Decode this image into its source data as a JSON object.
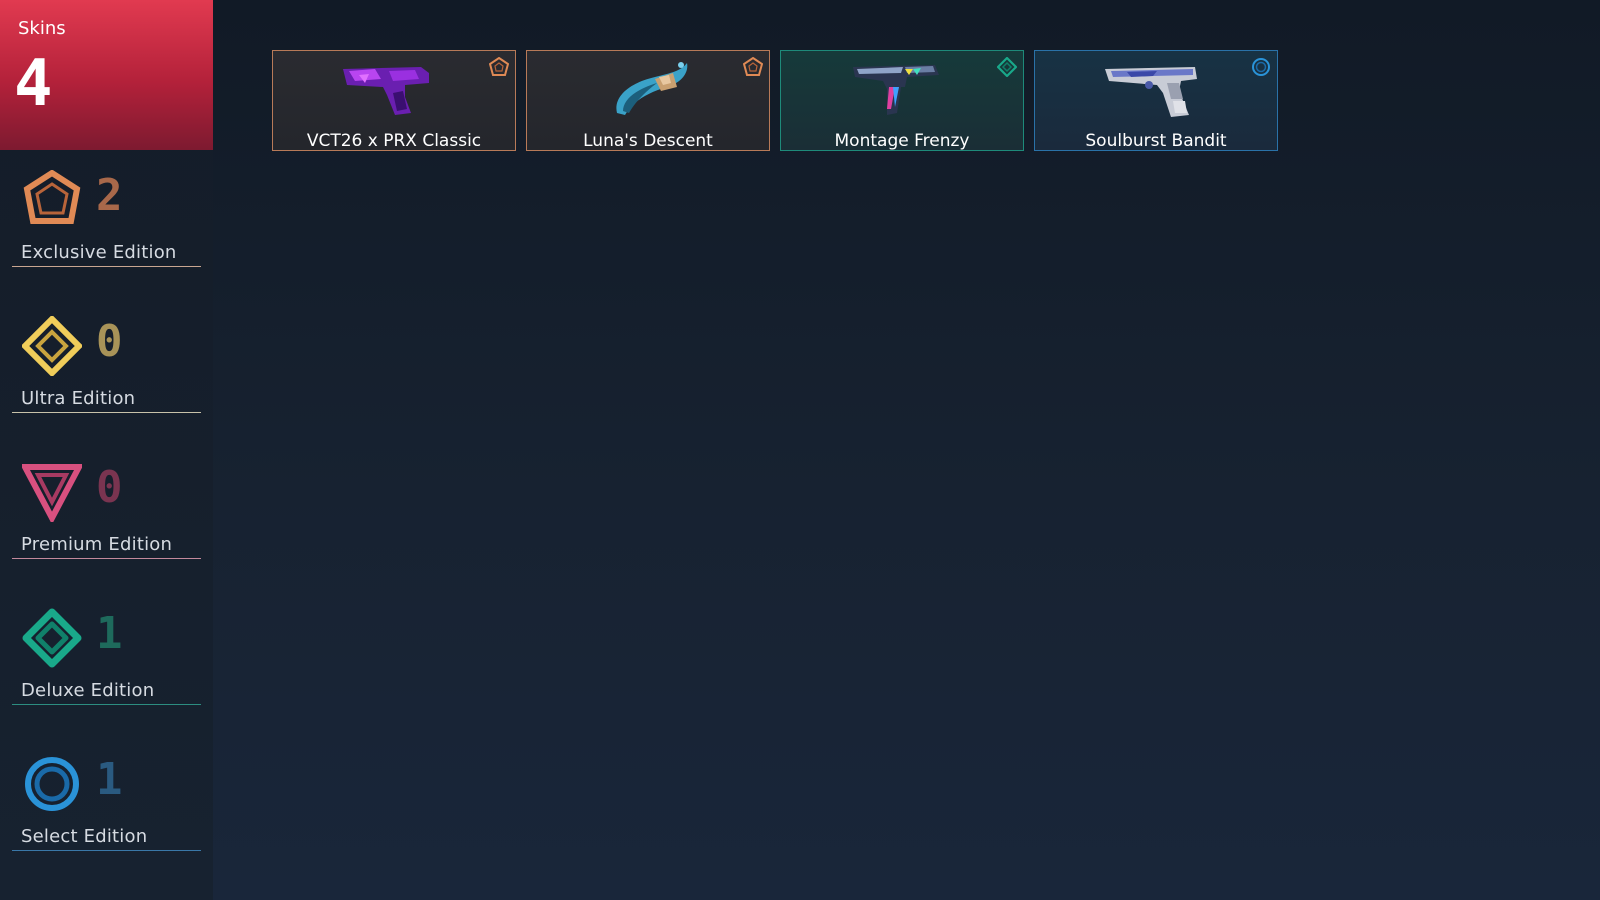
{
  "header": {
    "title": "Skins",
    "count": "4"
  },
  "colors": {
    "header_red": "#e13a50",
    "exclusive": "#e08a55",
    "ultra": "#f0cd5a",
    "premium": "#d8507f",
    "deluxe": "#19a98a",
    "select": "#2a93d8"
  },
  "tiers": [
    {
      "label": "Exclusive Edition",
      "count": "2",
      "icon": "exclusive-edition-icon",
      "color": "#e08a55"
    },
    {
      "label": "Ultra Edition",
      "count": "0",
      "icon": "ultra-edition-icon",
      "color": "#f0cd5a"
    },
    {
      "label": "Premium Edition",
      "count": "0",
      "icon": "premium-edition-icon",
      "color": "#d8507f"
    },
    {
      "label": "Deluxe Edition",
      "count": "1",
      "icon": "deluxe-edition-icon",
      "color": "#19a98a"
    },
    {
      "label": "Select Edition",
      "count": "1",
      "icon": "select-edition-icon",
      "color": "#2a93d8"
    }
  ],
  "skins": [
    {
      "name": "VCT26 x PRX Classic",
      "tier": "exclusive",
      "weapon_icon": "classic-pistol-icon"
    },
    {
      "name": "Luna's Descent",
      "tier": "exclusive",
      "weapon_icon": "knife-icon"
    },
    {
      "name": "Montage Frenzy",
      "tier": "deluxe",
      "weapon_icon": "frenzy-pistol-icon"
    },
    {
      "name": "Soulburst Bandit",
      "tier": "select",
      "weapon_icon": "bandit-pistol-icon"
    }
  ]
}
